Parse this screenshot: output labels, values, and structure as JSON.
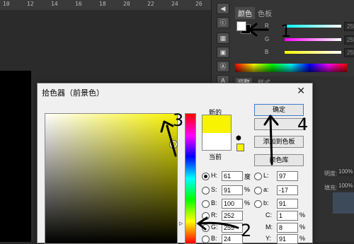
{
  "ruler": {
    "ticks": [
      "10",
      "12",
      "14",
      "16",
      "18",
      "20",
      "22",
      "24",
      "26"
    ]
  },
  "tool_strip": {
    "buttons": [
      "◀",
      "ⓒ",
      "▦",
      "▣",
      "Ⓐ",
      "A",
      "¶",
      "▤"
    ]
  },
  "color_panel": {
    "tabs": [
      "颜色",
      "色板"
    ],
    "sliders": [
      {
        "label": "R",
        "value": "255"
      },
      {
        "label": "G",
        "value": "255"
      },
      {
        "label": "B",
        "value": "255"
      }
    ],
    "lower_tabs": [
      "调整",
      "样式"
    ],
    "props": [
      "明度:",
      "100%",
      "填充:",
      "100%"
    ]
  },
  "picker": {
    "title": "拾色器（前景色）",
    "new_label": "新的",
    "current_label": "当前",
    "ok_label": "确定",
    "cancel_label": "",
    "add_swatch_label": "添加到色板",
    "library_label": "颜色库",
    "new_color": "#f8f300",
    "current_color": "#ffffff",
    "hsb": [
      {
        "label": "H:",
        "value": "61",
        "unit": "度",
        "checked": true
      },
      {
        "label": "S:",
        "value": "91",
        "unit": "%",
        "checked": false
      },
      {
        "label": "B:",
        "value": "100",
        "unit": "%",
        "checked": false
      }
    ],
    "rgb": [
      {
        "label": "R:",
        "value": "252"
      },
      {
        "label": "G:",
        "value": "255"
      },
      {
        "label": "B:",
        "value": "24"
      }
    ],
    "lab": [
      {
        "label": "L:",
        "value": "97"
      },
      {
        "label": "a:",
        "value": "-17"
      },
      {
        "label": "b:",
        "value": "91"
      }
    ],
    "cmyk": [
      {
        "label": "C:",
        "value": "1",
        "unit": "%"
      },
      {
        "label": "M:",
        "value": "8",
        "unit": "%"
      },
      {
        "label": "Y:",
        "value": "91",
        "unit": "%"
      }
    ]
  },
  "annotations": {
    "n1": "1",
    "n2": "2",
    "n3": "3",
    "n4": "4"
  }
}
